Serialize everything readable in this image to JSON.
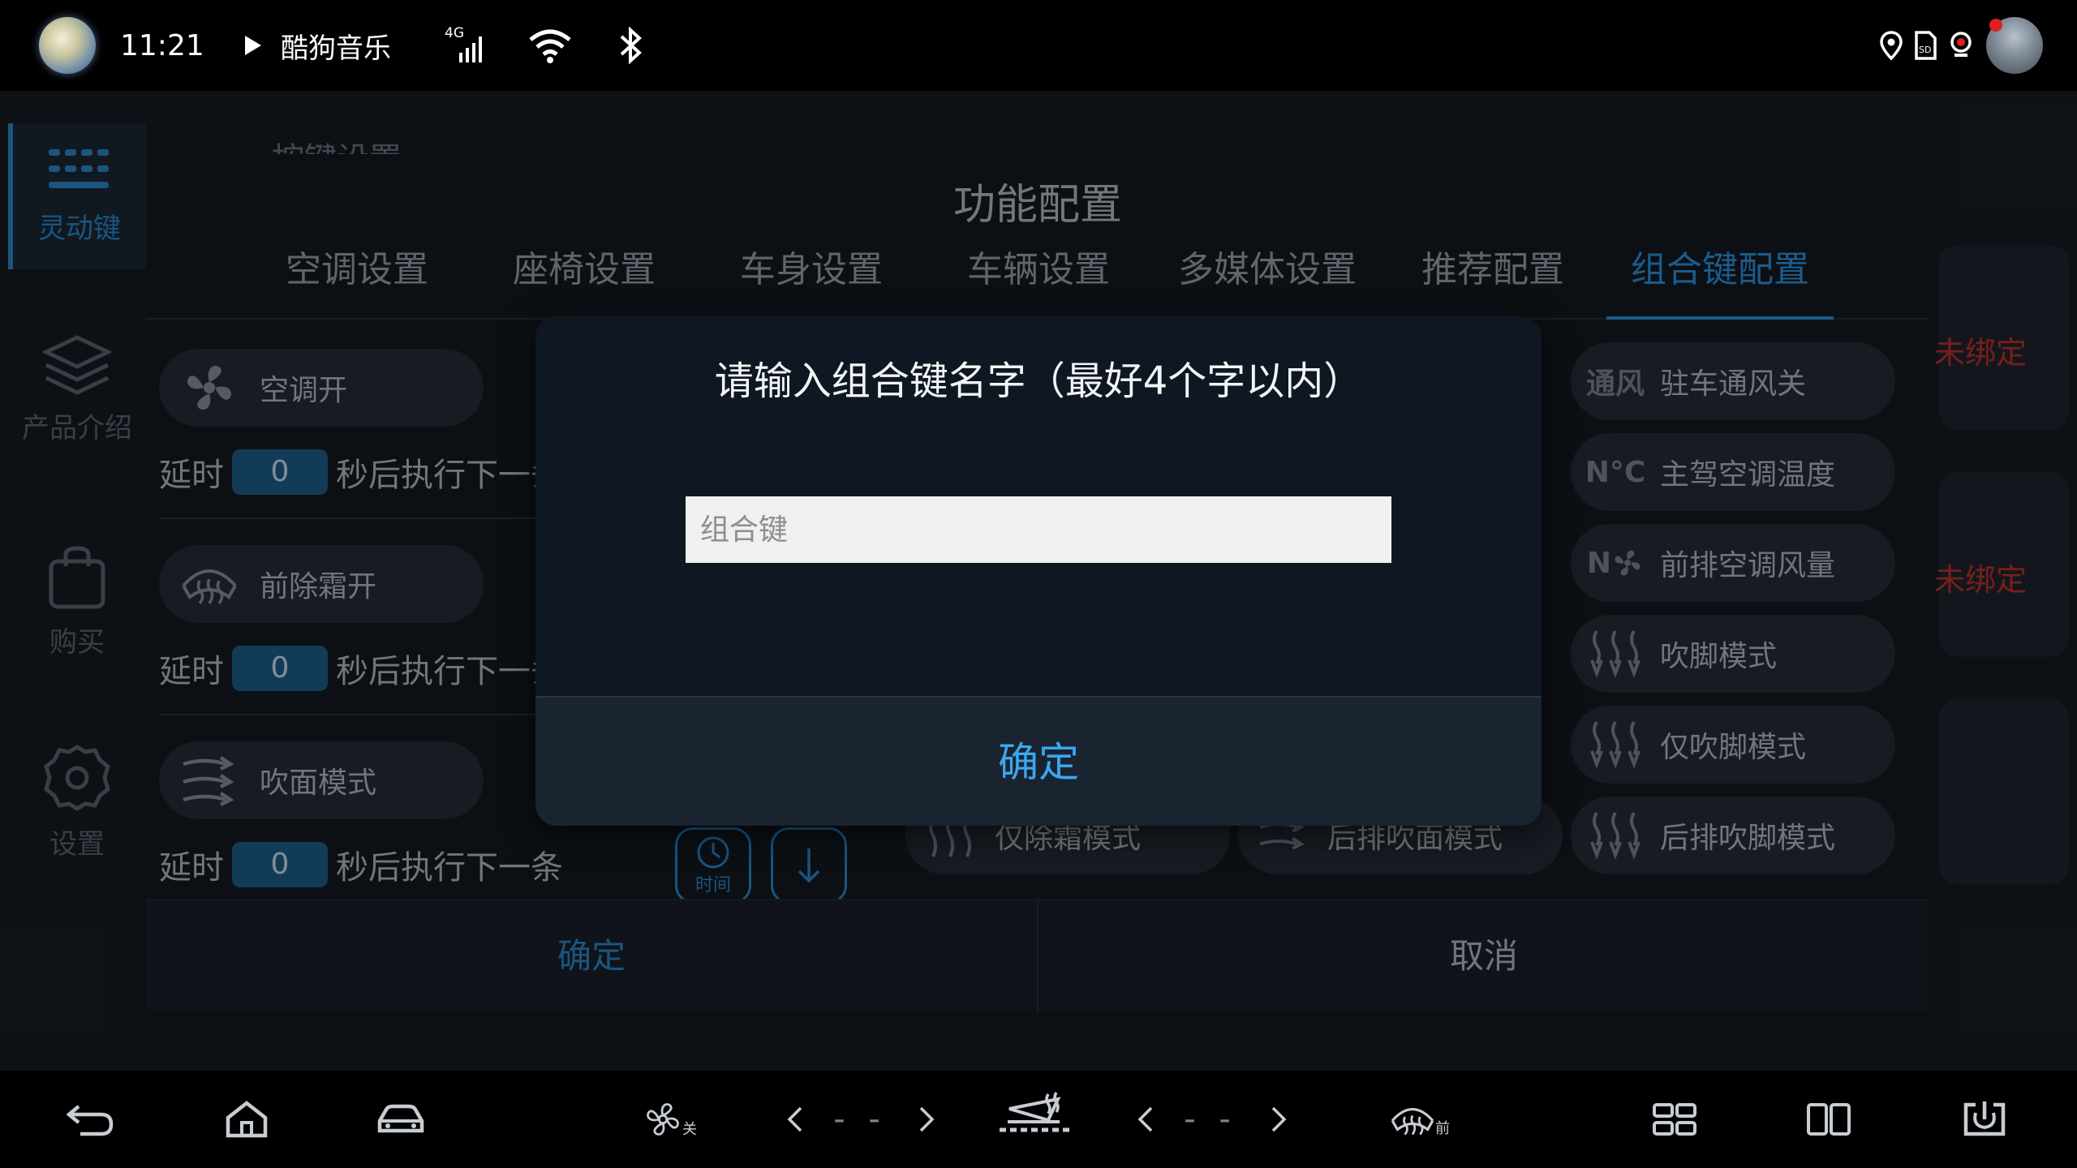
{
  "status_bar": {
    "time": "11:21",
    "music_app": "酷狗音乐",
    "network": "4G"
  },
  "left_nav": {
    "items": [
      {
        "label": "灵动键",
        "active": true
      },
      {
        "label": "产品介绍",
        "active": false
      },
      {
        "label": "购买",
        "active": false
      },
      {
        "label": "设置",
        "active": false
      }
    ]
  },
  "background_page": {
    "heading": "按键设置",
    "unbound_1": "未绑定",
    "unbound_2": "未绑定"
  },
  "panel": {
    "title": "功能配置",
    "tabs": [
      "空调设置",
      "座椅设置",
      "车身设置",
      "车辆设置",
      "多媒体设置",
      "推荐配置",
      "组合键配置"
    ],
    "active_tab": "组合键配置",
    "steps": [
      {
        "label": "空调开",
        "icon": "fan-icon",
        "delay_prefix": "延时",
        "delay": "0",
        "delay_suffix": "秒后执行下一条"
      },
      {
        "label": "前除霜开",
        "icon": "front-defrost-icon",
        "delay_prefix": "延时",
        "delay": "0",
        "delay_suffix": "秒后执行下一条"
      },
      {
        "label": "吹面模式",
        "icon": "face-vent-icon",
        "delay_prefix": "延时",
        "delay": "0",
        "delay_suffix": "秒后执行下一条"
      }
    ],
    "time_button_label": "时间",
    "grid_right": [
      {
        "icon_text": "通风",
        "label": "驻车通风关"
      },
      {
        "icon_text": "N°C",
        "label": "主驾空调温度"
      },
      {
        "icon_text": "N",
        "label": "前排空调风量"
      },
      {
        "icon_text": "",
        "label": "吹脚模式"
      },
      {
        "icon_text": "",
        "label": "仅吹脚模式"
      },
      {
        "icon_text": "",
        "label": "后排吹脚模式"
      }
    ],
    "grid_bottom": [
      {
        "label": "仅除霜模式"
      },
      {
        "label": "后排吹面模式"
      }
    ],
    "confirm_label": "确定",
    "cancel_label": "取消"
  },
  "dialog": {
    "title": "请输入组合键名字（最好4个字以内）",
    "input_placeholder": "组合键",
    "input_value": "",
    "confirm_label": "确定"
  },
  "dock": {
    "fan_status": "关",
    "left_temp": "- -",
    "right_temp": "- -",
    "defrost_label": "前"
  },
  "colors": {
    "accent": "#2e94e0",
    "unbound_red": "#c0332b",
    "dialog_bg": "#0f1822",
    "dialog_button_text": "#3aa7ee"
  }
}
